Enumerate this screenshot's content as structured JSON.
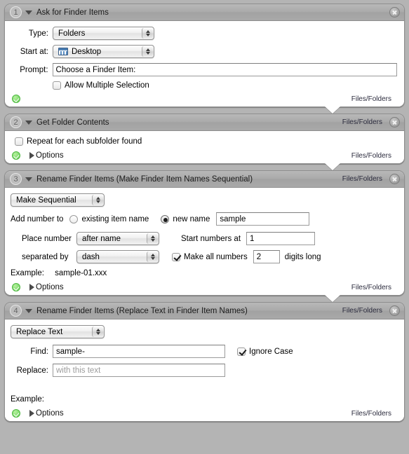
{
  "app": "Automator Workflow",
  "connector_label": "Files/Folders",
  "actions": [
    {
      "number": "1",
      "title": "Ask for Finder Items",
      "header_kind": "",
      "footer_kind": "Files/Folders",
      "has_options": false,
      "fields": {
        "type_label": "Type:",
        "type_value": "Folders",
        "start_label": "Start at:",
        "start_value": "Desktop",
        "prompt_label": "Prompt:",
        "prompt_value": "Choose a Finder Item:",
        "allow_multiple_label": "Allow Multiple Selection",
        "allow_multiple_checked": false
      }
    },
    {
      "number": "2",
      "title": "Get Folder Contents",
      "header_kind": "Files/Folders",
      "footer_kind": "Files/Folders",
      "options_label": "Options",
      "has_options": true,
      "fields": {
        "repeat_label": "Repeat for each subfolder found",
        "repeat_checked": false
      }
    },
    {
      "number": "3",
      "title": "Rename Finder Items (Make Finder Item Names Sequential)",
      "header_kind": "Files/Folders",
      "footer_kind": "Files/Folders",
      "options_label": "Options",
      "has_options": true,
      "fields": {
        "mode_value": "Make Sequential",
        "add_number_label": "Add number to",
        "existing_name_label": "existing item name",
        "existing_name_selected": false,
        "new_name_label": "new name",
        "new_name_selected": true,
        "new_name_value": "sample",
        "place_number_label": "Place number",
        "place_number_value": "after name",
        "start_numbers_label": "Start numbers at",
        "start_numbers_value": "1",
        "separated_by_label": "separated by",
        "separated_by_value": "dash",
        "make_all_numbers_label": "Make all numbers",
        "make_all_numbers_checked": true,
        "digits_value": "2",
        "digits_long_label": "digits long",
        "example_label": "Example:",
        "example_value": "sample-01.xxx"
      }
    },
    {
      "number": "4",
      "title": "Rename Finder Items (Replace Text in Finder Item Names)",
      "header_kind": "Files/Folders",
      "footer_kind": "Files/Folders",
      "options_label": "Options",
      "has_options": true,
      "fields": {
        "mode_value": "Replace Text",
        "find_label": "Find:",
        "find_value": "sample-",
        "ignore_case_label": "Ignore Case",
        "ignore_case_checked": true,
        "replace_label": "Replace:",
        "replace_placeholder": "with this text",
        "example_label": "Example:",
        "example_value": ""
      }
    }
  ],
  "colors": {
    "background": "#b4b4b4",
    "header_bar": "#aaaaaa",
    "card": "#ffffff",
    "status_green": "#5fce4e",
    "kind_label": "#2b2b3d"
  }
}
